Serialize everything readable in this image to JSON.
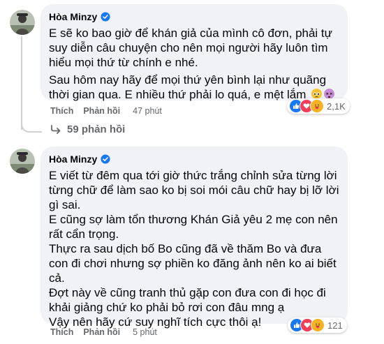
{
  "comments": [
    {
      "author": "Hòa Minzy",
      "paragraphs": [
        "E sẽ ko bao giờ để khán giả của mình cô đơn, phải tự suy diễn câu chuyện cho nên mọi người hãy luôn tìm hiểu mọi thứ từ chính e nhé.",
        "Sau hôm nay hãy để mọi thứ yên bình lại như quãng thời gian qua. E nhiều thứ phải lo quá, e mệt lắm"
      ],
      "emojis": [
        "pleading-face",
        "dizzy-face"
      ],
      "like_label": "Thích",
      "reply_label": "Phản hồi",
      "time": "47 phút",
      "reactions": [
        "like",
        "love",
        "care"
      ],
      "reaction_count": "2,1K"
    },
    {
      "author": "Hòa Minzy",
      "paragraphs": [
        "E viết từ đêm qua tới giờ thức trắng chỉnh sửa từng lời từng chữ để làm sao ko bị soi mói câu chữ hay bị lỡ lời gì sai.",
        "E cũng sợ làm tổn thương Khán Giả yêu 2 mẹ con nên rất cẩn trọng.",
        "Thực ra sau dịch bố Bo cũng đã về thăm Bo và đưa con đi chơi nhưng sợ phiền ko đăng ảnh nên ko ai biết cả.",
        "Đợt này về cũng tranh thủ gặp con đưa con đi học đi khải giảng chứ ko phải bỏ rơi con đâu mng ạ",
        "Vậy nên hãy cứ suy nghĩ tích cực thôi ạ!"
      ],
      "like_label": "Thích",
      "reply_label": "Phản hồi",
      "time": "5 phút",
      "reactions": [
        "like",
        "love",
        "care"
      ],
      "reaction_count": "121"
    }
  ],
  "replies_label": "59 phản hồi",
  "colors": {
    "bubble": "#f0f2f5",
    "verified": "#1877f2",
    "like": "#1877f2",
    "love": "#f33e58",
    "care": "#f7b125",
    "meta": "#65676b"
  }
}
